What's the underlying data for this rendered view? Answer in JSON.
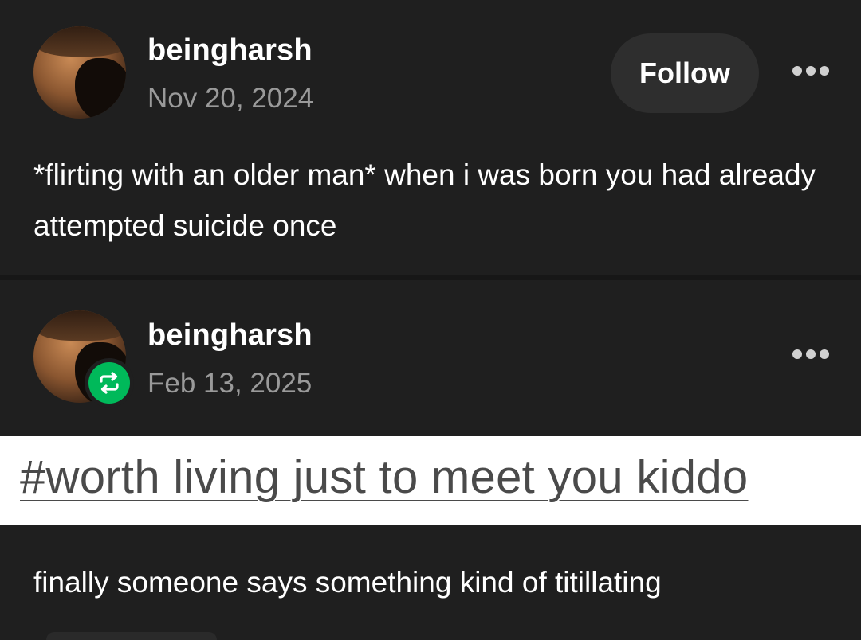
{
  "posts": [
    {
      "username": "beingharsh",
      "date": "Nov 20, 2024",
      "follow_label": "Follow",
      "text": "*flirting with an older man* when i was born you had already attempted suicide once"
    },
    {
      "username": "beingharsh",
      "date": "Feb 13, 2025",
      "tag": "#worth living just to meet you kiddo",
      "text": "finally someone says something kind of titillating"
    }
  ],
  "colors": {
    "background": "#1f1f1f",
    "reblog_green": "#00b95a",
    "date_gray": "#9a9a9a"
  },
  "icons": [
    "more-options-icon",
    "reblog-icon"
  ]
}
